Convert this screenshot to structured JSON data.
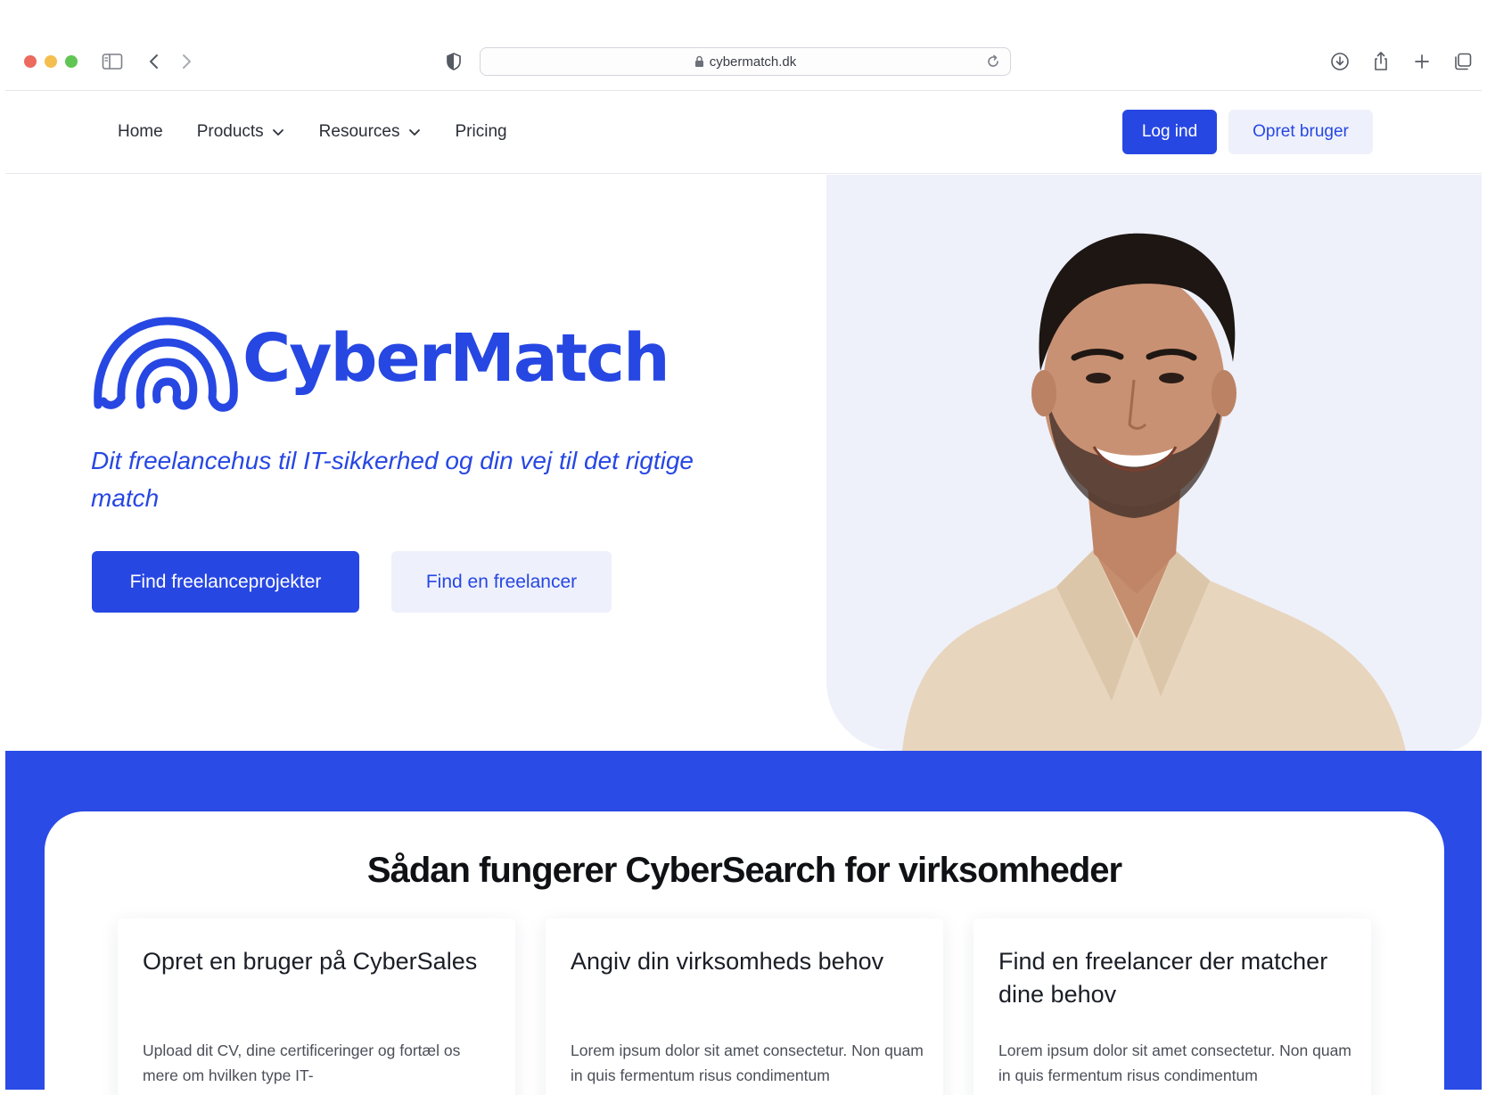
{
  "browser": {
    "url": "cybermatch.dk"
  },
  "nav": {
    "links": [
      {
        "label": "Home"
      },
      {
        "label": "Products"
      },
      {
        "label": "Resources"
      },
      {
        "label": "Pricing"
      }
    ],
    "login_label": "Log ind",
    "signup_label": "Opret bruger"
  },
  "hero": {
    "logo_text": "CyberMatch",
    "tagline": "Dit freelancehus til IT-sikkerhed og din vej til det rigtige match",
    "primary_cta": "Find freelanceprojekter",
    "secondary_cta": "Find en freelancer"
  },
  "how": {
    "title": "Sådan fungerer CyberSearch for virksomheder",
    "cards": [
      {
        "title": "Opret en bruger på CyberSales",
        "body": "Upload dit CV, dine certificeringer og fortæl os mere om hvilken type IT-"
      },
      {
        "title": "Angiv din virksomheds behov",
        "body": "Lorem ipsum dolor sit amet consectetur. Non quam in quis fermentum risus condimentum"
      },
      {
        "title": "Find en freelancer der matcher dine behov",
        "body": "Lorem ipsum dolor sit amet consectetur. Non quam in quis fermentum risus condimentum"
      }
    ]
  },
  "colors": {
    "brand_blue": "#2747e3",
    "band_blue": "#2a4be6",
    "light_blue_bg": "#eef1fa"
  }
}
